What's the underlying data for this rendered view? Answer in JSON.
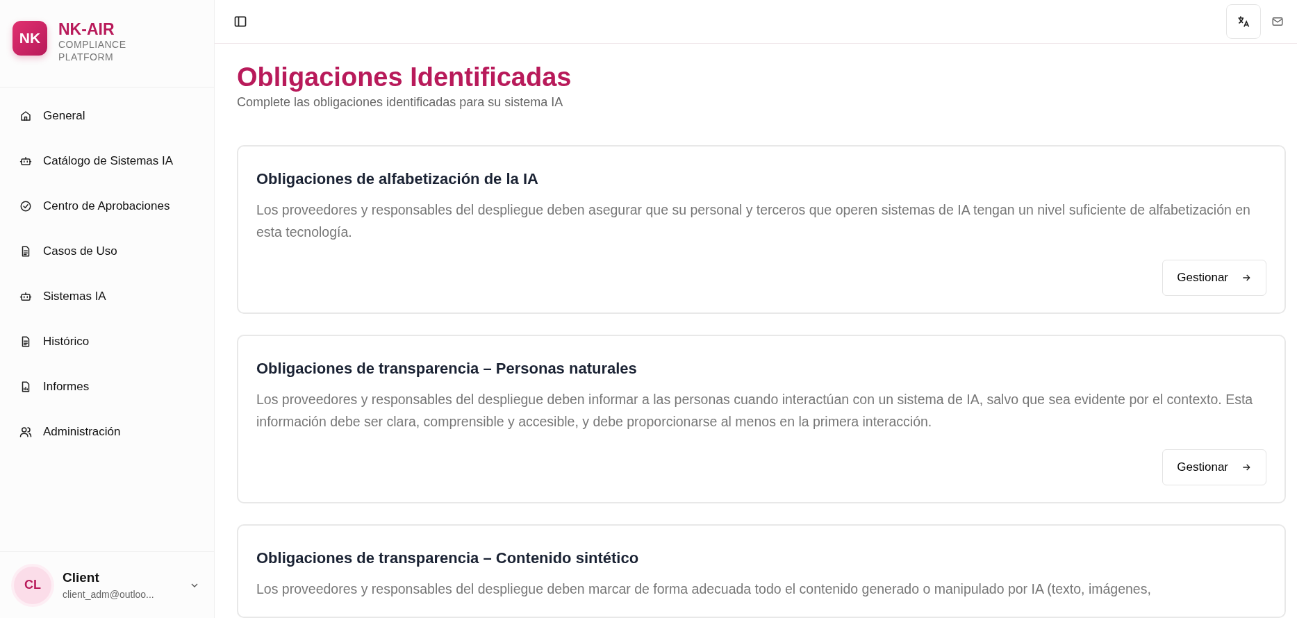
{
  "brand": {
    "logo": "NK",
    "name": "NK-AIR",
    "subtitle": "COMPLIANCE PLATFORM"
  },
  "sidebar": {
    "items": [
      {
        "label": "General",
        "kind": "home",
        "selected": false
      },
      {
        "label": "Catálogo de Sistemas IA",
        "kind": "bot",
        "selected": false
      },
      {
        "label": "Centro de Aprobaciones",
        "kind": "check",
        "selected": false
      },
      {
        "label": "Casos de Uso",
        "kind": "doc",
        "selected": false
      },
      {
        "label": "Sistemas IA",
        "kind": "bot",
        "selected": false
      },
      {
        "label": "Histórico",
        "kind": "doc",
        "selected": false
      },
      {
        "label": "Informes",
        "kind": "chart",
        "selected": false
      },
      {
        "label": "Administración",
        "kind": "users",
        "selected": false
      }
    ]
  },
  "user": {
    "initials": "CL",
    "name": "Client",
    "email": "client_adm@outloo..."
  },
  "page": {
    "title": "Obligaciones Identificadas",
    "subtitle": "Complete las obligaciones identificadas para su sistema IA"
  },
  "obligations": [
    {
      "title": "Obligaciones de alfabetización de la IA",
      "description": "Los proveedores y responsables del despliegue deben asegurar que su personal y terceros que operen sistemas de IA tengan un nivel suficiente de alfabetización en esta tecnología.",
      "button": "Gestionar"
    },
    {
      "title": "Obligaciones de transparencia – Personas naturales",
      "description": "Los proveedores y responsables del despliegue deben informar a las personas cuando interactúan con un sistema de IA, salvo que sea evidente por el contexto. Esta información debe ser clara, comprensible y accesible, y debe proporcionarse al menos en la primera interacción.",
      "button": "Gestionar"
    },
    {
      "title": "Obligaciones de transparencia – Contenido sintético",
      "description": "Los proveedores y responsables del despliegue deben marcar de forma adecuada todo el contenido generado o manipulado por IA (texto, imágenes,"
    }
  ]
}
